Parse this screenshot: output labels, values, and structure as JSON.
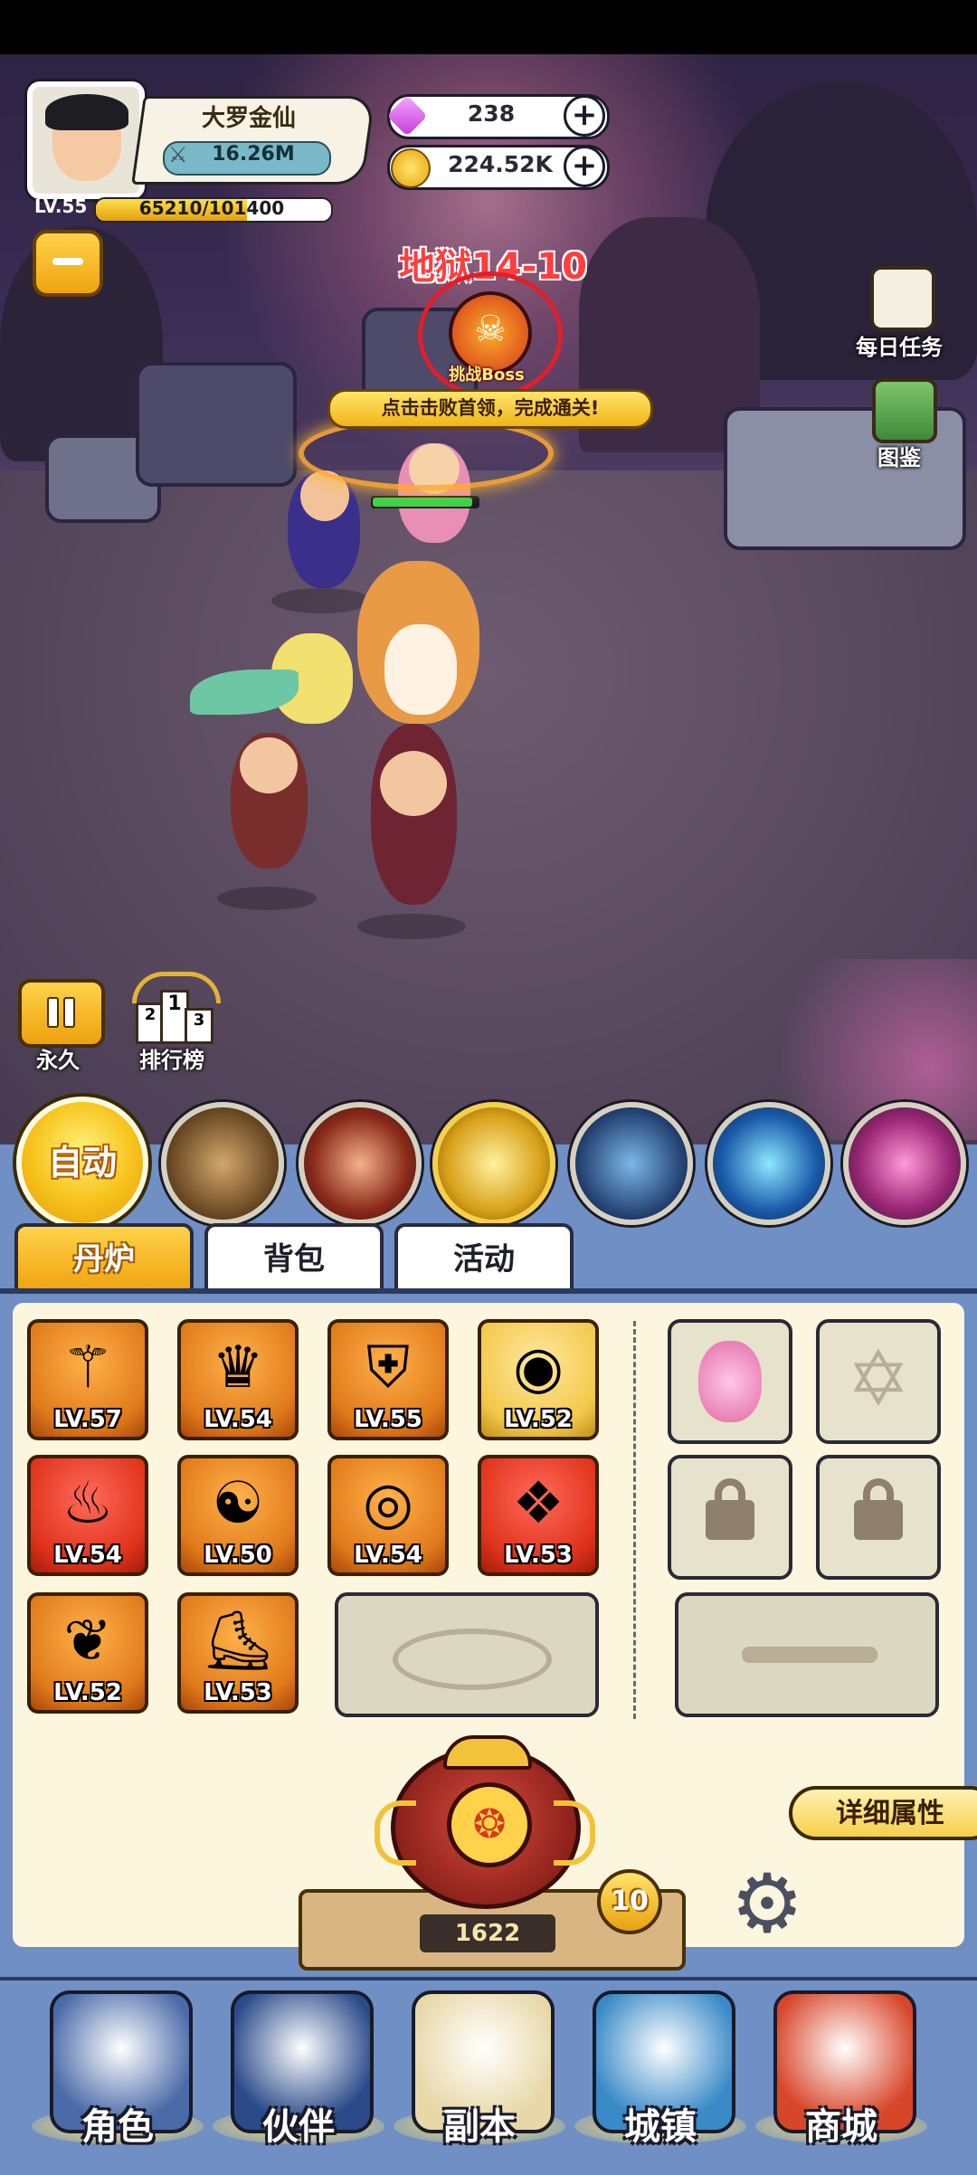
{
  "player": {
    "name": "大罗金仙",
    "power": "16.26M",
    "level": "LV.55",
    "xp_text": "65210/101400",
    "xp_progress": 0.643
  },
  "currency": {
    "gems": "238",
    "gold": "224.52K"
  },
  "stage": {
    "title": "地狱14-10",
    "boss_button": "挑战Boss",
    "hint": "点击击败首领，完成通关!"
  },
  "side_buttons": {
    "daily_tasks": "每日任务",
    "codex": "图鉴"
  },
  "bottom_left": {
    "pause_label": "永久",
    "ranking_label": "排行榜",
    "ranking_digits": [
      "2",
      "1",
      "3"
    ]
  },
  "skills": {
    "auto_label": "自动",
    "icons": [
      "skill-turtle-icon",
      "skill-tornado-icon",
      "skill-swords-icon",
      "skill-lightning-scroll-icon",
      "skill-blue-flame-icon",
      "skill-vortex-icon"
    ]
  },
  "tabs": [
    "丹炉",
    "背包",
    "活动"
  ],
  "equipment": [
    {
      "level": "LV.57",
      "icon": "spear-icon",
      "rarity": "orange"
    },
    {
      "level": "LV.54",
      "icon": "crown-icon",
      "rarity": "orange"
    },
    {
      "level": "LV.55",
      "icon": "armor-icon",
      "rarity": "orange"
    },
    {
      "level": "LV.52",
      "icon": "crystal-ball-icon",
      "rarity": "gold"
    },
    {
      "level": "LV.54",
      "icon": "flame-icon",
      "rarity": "red"
    },
    {
      "level": "LV.50",
      "icon": "bagua-icon",
      "rarity": "orange"
    },
    {
      "level": "LV.54",
      "icon": "jade-ring-icon",
      "rarity": "orange"
    },
    {
      "level": "LV.53",
      "icon": "orb-icon",
      "rarity": "red"
    },
    {
      "level": "LV.52",
      "icon": "necklace-icon",
      "rarity": "orange"
    },
    {
      "level": "LV.53",
      "icon": "boots-icon",
      "rarity": "orange"
    }
  ],
  "furnace": {
    "count": "1622",
    "level": "10",
    "detail_label": "详细属性"
  },
  "nav": [
    "角色",
    "伙伴",
    "副本",
    "城镇",
    "商城"
  ],
  "colors": {
    "panel_blue": "#6f8fc5",
    "accent_gold": "#f6c21a",
    "stage_red": "#ff3e3e"
  }
}
